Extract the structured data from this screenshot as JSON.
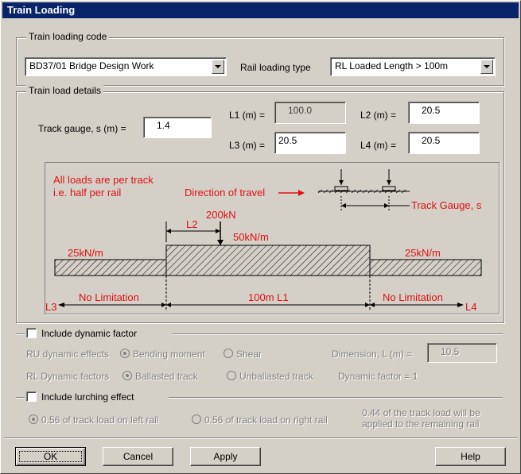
{
  "window": {
    "title": "Train Loading"
  },
  "train_loading_code": {
    "legend": "Train loading code",
    "code_value": "BD37/01 Bridge Design Work",
    "rail_loading_type_label": "Rail loading type",
    "rail_loading_type_value": "RL Loaded Length > 100m"
  },
  "train_load_details": {
    "legend": "Train load details",
    "track_gauge_label": "Track gauge, s (m) =",
    "track_gauge_value": "1.4",
    "l1_label": "L1 (m) =",
    "l1_value": "100.0",
    "l2_label": "L2 (m) =",
    "l2_value": "20.5",
    "l3_label": "L3 (m) =",
    "l3_value": "20.5",
    "l4_label": "L4 (m) =",
    "l4_value": "20.5"
  },
  "diagram": {
    "note_line1": "All loads are per track",
    "note_line2": "i.e. half per rail",
    "direction": "Direction of travel",
    "track_gauge": "Track Gauge, s",
    "point_load": "200kN",
    "l2": "L2",
    "udl_center": "50kN/m",
    "udl_left": "25kN/m",
    "udl_right": "25kN/m",
    "no_limit_left": "No Limitation",
    "no_limit_right": "No Limitation",
    "l1": "100m L1",
    "l3": "L3",
    "l4": "L4",
    "text_color": "#e01010"
  },
  "dynamic": {
    "checkbox_label": "Include dynamic factor",
    "checked": false,
    "ru_label": "RU dynamic effects",
    "bending_moment": "Bending moment",
    "shear": "Shear",
    "dimension_label": "Dimension, L (m) =",
    "dimension_value": "10.5",
    "rl_label": "RL Dynamic factors",
    "ballasted": "Ballasted track",
    "unballasted": "Unballasted track",
    "dynamic_factor": "Dynamic factor = 1"
  },
  "lurching": {
    "checkbox_label": "Include lurching effect",
    "checked": false,
    "left_rail": "0.56 of track load on left rail",
    "right_rail": "0.56 of track load on right rail",
    "note_line1": "0.44 of the track load will be",
    "note_line2": "applied to the remaining rail"
  },
  "buttons": {
    "ok": "OK",
    "cancel": "Cancel",
    "apply": "Apply",
    "help": "Help"
  }
}
